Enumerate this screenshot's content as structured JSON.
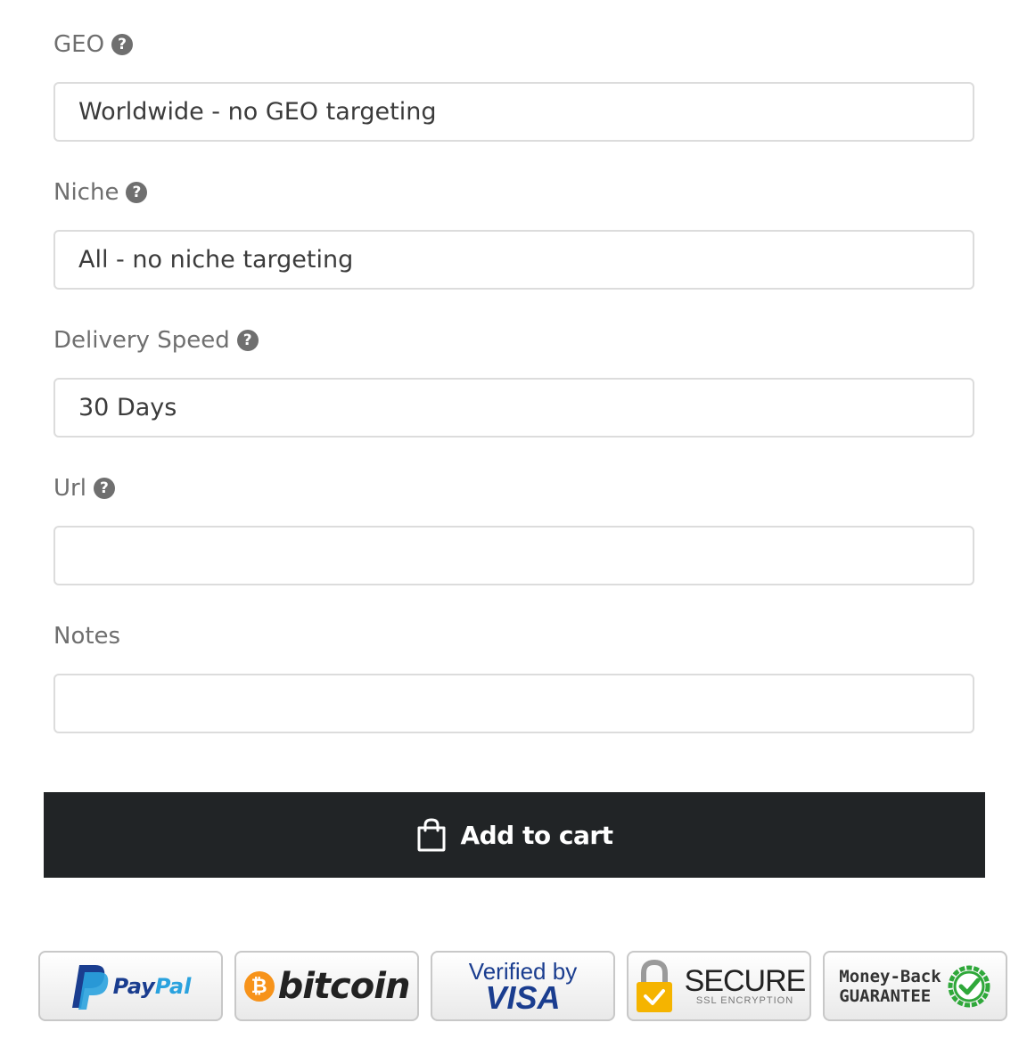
{
  "form": {
    "geo": {
      "label": "GEO",
      "value": "Worldwide - no GEO targeting"
    },
    "niche": {
      "label": "Niche",
      "value": "All - no niche targeting"
    },
    "delivery": {
      "label": "Delivery Speed",
      "value": "30 Days"
    },
    "url": {
      "label": "Url",
      "value": ""
    },
    "notes": {
      "label": "Notes",
      "value": ""
    },
    "help_glyph": "?"
  },
  "cart_button": {
    "label": "Add to cart",
    "icon": "shopping-bag-icon"
  },
  "badges": {
    "paypal": {
      "text_pay": "Pay",
      "text_pal": "Pal",
      "icon": "paypal-logo-icon",
      "colors": {
        "dark": "#1a3d8f",
        "light": "#2aa2de"
      }
    },
    "bitcoin": {
      "text": "bitcoin",
      "symbol": "₿",
      "icon": "bitcoin-logo-icon",
      "color": "#f7931a"
    },
    "visa": {
      "top": "Verified by",
      "main": "VISA"
    },
    "secure": {
      "main": "SECURE",
      "sub": "SSL ENCRYPTION",
      "icon": "padlock-icon",
      "color": "#f5b400"
    },
    "moneyback": {
      "line1": "Money-Back",
      "line2": "GUARANTEE",
      "icon": "check-circle-icon",
      "color": "#2fa83a"
    }
  }
}
